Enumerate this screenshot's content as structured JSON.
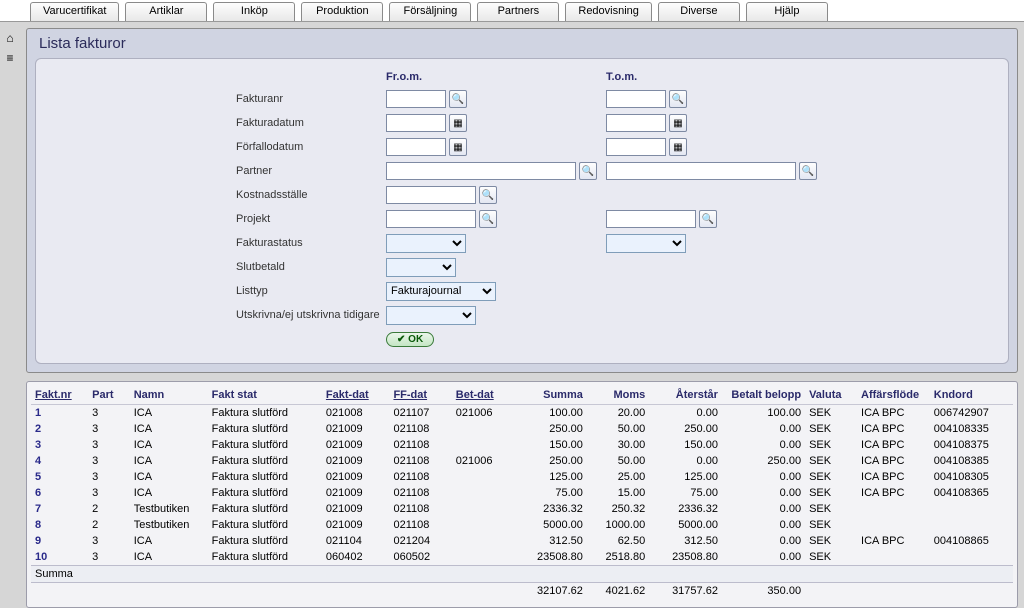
{
  "tabs": [
    "Varucertifikat",
    "Artiklar",
    "Inköp",
    "Produktion",
    "Försäljning",
    "Partners",
    "Redovisning",
    "Diverse",
    "Hjälp"
  ],
  "title": "Lista fakturor",
  "filter": {
    "col_from": "Fr.o.m.",
    "col_to": "T.o.m.",
    "fakturanr": "Fakturanr",
    "fakturadatum": "Fakturadatum",
    "forfallodatum": "Förfallodatum",
    "partner": "Partner",
    "kostnadsstalle": "Kostnadsställe",
    "projekt": "Projekt",
    "fakturastatus": "Fakturastatus",
    "slutbetald": "Slutbetald",
    "listtyp": "Listtyp",
    "listtyp_value": "Fakturajournal",
    "utskrivna": "Utskrivna/ej utskrivna tidigare",
    "ok": "OK"
  },
  "columns": {
    "faktnr": "Fakt.nr",
    "part": "Part",
    "namn": "Namn",
    "faktstat": "Fakt stat",
    "faktdat": "Fakt-dat",
    "ffdat": "FF-dat",
    "betdat": "Bet-dat",
    "summa": "Summa",
    "moms": "Moms",
    "aterstar": "Återstår",
    "betaltbelopp": "Betalt belopp",
    "valuta": "Valuta",
    "affarsflode": "Affärsflöde",
    "kndord": "Kndord"
  },
  "rows": [
    {
      "n": "1",
      "part": "3",
      "namn": "ICA",
      "stat": "Faktura slutförd",
      "fdat": "021008",
      "ff": "021107",
      "bet": "021006",
      "sum": "100.00",
      "moms": "20.00",
      "ater": "0.00",
      "bb": "100.00",
      "val": "SEK",
      "af": "ICA BPC",
      "ko": "006742907"
    },
    {
      "n": "2",
      "part": "3",
      "namn": "ICA",
      "stat": "Faktura slutförd",
      "fdat": "021009",
      "ff": "021108",
      "bet": "",
      "sum": "250.00",
      "moms": "50.00",
      "ater": "250.00",
      "bb": "0.00",
      "val": "SEK",
      "af": "ICA BPC",
      "ko": "004108335"
    },
    {
      "n": "3",
      "part": "3",
      "namn": "ICA",
      "stat": "Faktura slutförd",
      "fdat": "021009",
      "ff": "021108",
      "bet": "",
      "sum": "150.00",
      "moms": "30.00",
      "ater": "150.00",
      "bb": "0.00",
      "val": "SEK",
      "af": "ICA BPC",
      "ko": "004108375"
    },
    {
      "n": "4",
      "part": "3",
      "namn": "ICA",
      "stat": "Faktura slutförd",
      "fdat": "021009",
      "ff": "021108",
      "bet": "021006",
      "sum": "250.00",
      "moms": "50.00",
      "ater": "0.00",
      "bb": "250.00",
      "val": "SEK",
      "af": "ICA BPC",
      "ko": "004108385"
    },
    {
      "n": "5",
      "part": "3",
      "namn": "ICA",
      "stat": "Faktura slutförd",
      "fdat": "021009",
      "ff": "021108",
      "bet": "",
      "sum": "125.00",
      "moms": "25.00",
      "ater": "125.00",
      "bb": "0.00",
      "val": "SEK",
      "af": "ICA BPC",
      "ko": "004108305"
    },
    {
      "n": "6",
      "part": "3",
      "namn": "ICA",
      "stat": "Faktura slutförd",
      "fdat": "021009",
      "ff": "021108",
      "bet": "",
      "sum": "75.00",
      "moms": "15.00",
      "ater": "75.00",
      "bb": "0.00",
      "val": "SEK",
      "af": "ICA BPC",
      "ko": "004108365"
    },
    {
      "n": "7",
      "part": "2",
      "namn": "Testbutiken",
      "stat": "Faktura slutförd",
      "fdat": "021009",
      "ff": "021108",
      "bet": "",
      "sum": "2336.32",
      "moms": "250.32",
      "ater": "2336.32",
      "bb": "0.00",
      "val": "SEK",
      "af": "",
      "ko": ""
    },
    {
      "n": "8",
      "part": "2",
      "namn": "Testbutiken",
      "stat": "Faktura slutförd",
      "fdat": "021009",
      "ff": "021108",
      "bet": "",
      "sum": "5000.00",
      "moms": "1000.00",
      "ater": "5000.00",
      "bb": "0.00",
      "val": "SEK",
      "af": "",
      "ko": ""
    },
    {
      "n": "9",
      "part": "3",
      "namn": "ICA",
      "stat": "Faktura slutförd",
      "fdat": "021104",
      "ff": "021204",
      "bet": "",
      "sum": "312.50",
      "moms": "62.50",
      "ater": "312.50",
      "bb": "0.00",
      "val": "SEK",
      "af": "ICA BPC",
      "ko": "004108865"
    },
    {
      "n": "10",
      "part": "3",
      "namn": "ICA",
      "stat": "Faktura slutförd",
      "fdat": "060402",
      "ff": "060502",
      "bet": "",
      "sum": "23508.80",
      "moms": "2518.80",
      "ater": "23508.80",
      "bb": "0.00",
      "val": "SEK",
      "af": "",
      "ko": ""
    }
  ],
  "sum_label": "Summa",
  "totals": {
    "sum": "32107.62",
    "moms": "4021.62",
    "ater": "31757.62",
    "bb": "350.00"
  }
}
